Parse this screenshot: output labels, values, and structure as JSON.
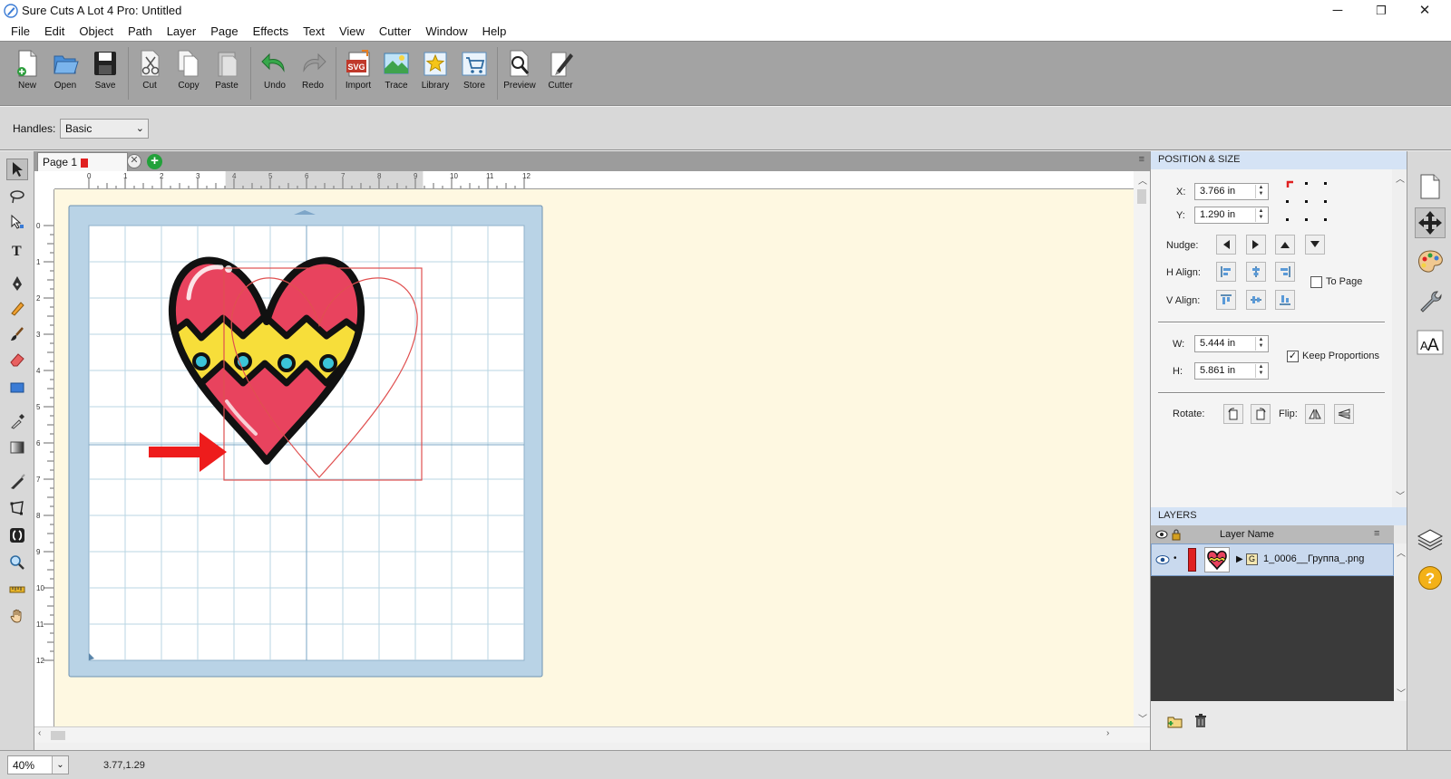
{
  "window": {
    "title": "Sure Cuts A Lot 4 Pro: Untitled",
    "controls": {
      "minimize": "─",
      "maximize": "❐",
      "close": "✕"
    }
  },
  "menu": [
    "File",
    "Edit",
    "Object",
    "Path",
    "Layer",
    "Page",
    "Effects",
    "Text",
    "View",
    "Cutter",
    "Window",
    "Help"
  ],
  "toolbar": {
    "new": "New",
    "open": "Open",
    "save": "Save",
    "cut": "Cut",
    "copy": "Copy",
    "paste": "Paste",
    "undo": "Undo",
    "redo": "Redo",
    "import": "Import",
    "trace": "Trace",
    "library": "Library",
    "store": "Store",
    "preview": "Preview",
    "cutter": "Cutter"
  },
  "handles": {
    "label": "Handles:",
    "value": "Basic"
  },
  "page_tab": {
    "label": "Page 1",
    "swatch_color": "#e02020"
  },
  "ruler": {
    "h_ticks": [
      "0",
      "1",
      "2",
      "3",
      "4",
      "5",
      "6",
      "7",
      "8",
      "9",
      "10",
      "11",
      "12"
    ],
    "v_ticks": [
      "0",
      "1",
      "2",
      "3",
      "4",
      "5",
      "6",
      "7",
      "8",
      "9",
      "10",
      "11",
      "12"
    ]
  },
  "position_size": {
    "title": "POSITION & SIZE",
    "x_label": "X:",
    "x_value": "3.766 in",
    "y_label": "Y:",
    "y_value": "1.290 in",
    "nudge_label": "Nudge:",
    "halign_label": "H Align:",
    "valign_label": "V Align:",
    "to_page_label": "To Page",
    "to_page_checked": false,
    "w_label": "W:",
    "w_value": "5.444 in",
    "h_label": "H:",
    "h_value": "5.861 in",
    "keep_proportions_label": "Keep Proportions",
    "keep_proportions_checked": true,
    "rotate_label": "Rotate:",
    "flip_label": "Flip:"
  },
  "layers": {
    "title": "LAYERS",
    "column_header": "Layer Name",
    "rows": [
      {
        "name": "1_0006__Группа_.png",
        "color": "#e02020",
        "visible": true
      }
    ]
  },
  "status": {
    "zoom": "40%",
    "coords": "3.77,1.29"
  },
  "colors": {
    "accent_red": "#e02020",
    "mat_blue": "#b9d3e6",
    "canvas_bg": "#fef8e1",
    "selection": "#e05050"
  },
  "icons": {
    "tools": [
      "select-arrow-icon",
      "lasso-icon",
      "node-edit-icon",
      "text-icon",
      "pen-icon",
      "pencil-icon",
      "brush-icon",
      "eraser-icon",
      "rectangle-icon",
      "eyedropper-icon",
      "gradient-icon",
      "knife-icon",
      "transform-icon",
      "weld-icon",
      "zoom-icon",
      "ruler-icon",
      "hand-icon"
    ],
    "sidebar": [
      "page-icon",
      "move-icon",
      "palette-icon",
      "wrench-icon",
      "font-icon",
      "layers-icon",
      "help-icon"
    ]
  }
}
